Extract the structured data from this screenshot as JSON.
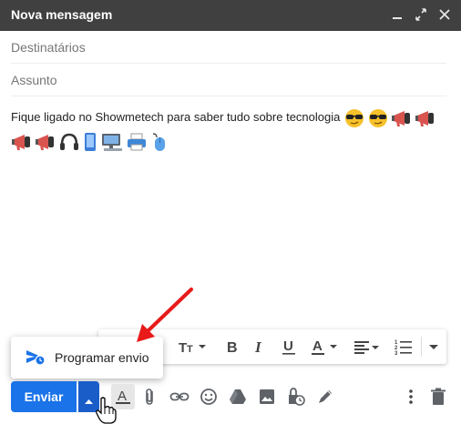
{
  "window": {
    "title": "Nova mensagem",
    "controls": {
      "minimize": "minimize-icon",
      "expand": "expand-icon",
      "close": "close-icon"
    }
  },
  "fields": {
    "to_placeholder": "Destinatários",
    "subject_placeholder": "Assunto"
  },
  "message": {
    "text": "Fique ligado no Showmetech para saber tudo sobre tecnologia",
    "emojis_line1": [
      "sunglasses-face",
      "sunglasses-face",
      "megaphone",
      "megaphone"
    ],
    "emojis_line2": [
      "megaphone",
      "megaphone",
      "headphones",
      "mobile-phone",
      "desktop-computer",
      "printer",
      "computer-mouse"
    ]
  },
  "schedule_menu": {
    "item_label": "Programar envio",
    "icon": "schedule-send-icon"
  },
  "format_toolbar": {
    "buttons": [
      "text-size",
      "bold",
      "italic",
      "underline",
      "text-color",
      "align",
      "numbered-list",
      "more-formatting"
    ]
  },
  "send_button": {
    "label": "Enviar"
  },
  "bottom_toolbar": {
    "icons": [
      "formatting-options",
      "attach-file",
      "insert-link",
      "insert-emoji",
      "google-drive",
      "insert-photo",
      "confidential-mode",
      "signature",
      "more-options",
      "discard-draft"
    ]
  },
  "colors": {
    "titlebar": "#404040",
    "send_blue": "#1a73e8",
    "send_more_blue": "#1a5dc9",
    "annotation_arrow": "#e81a1a"
  }
}
